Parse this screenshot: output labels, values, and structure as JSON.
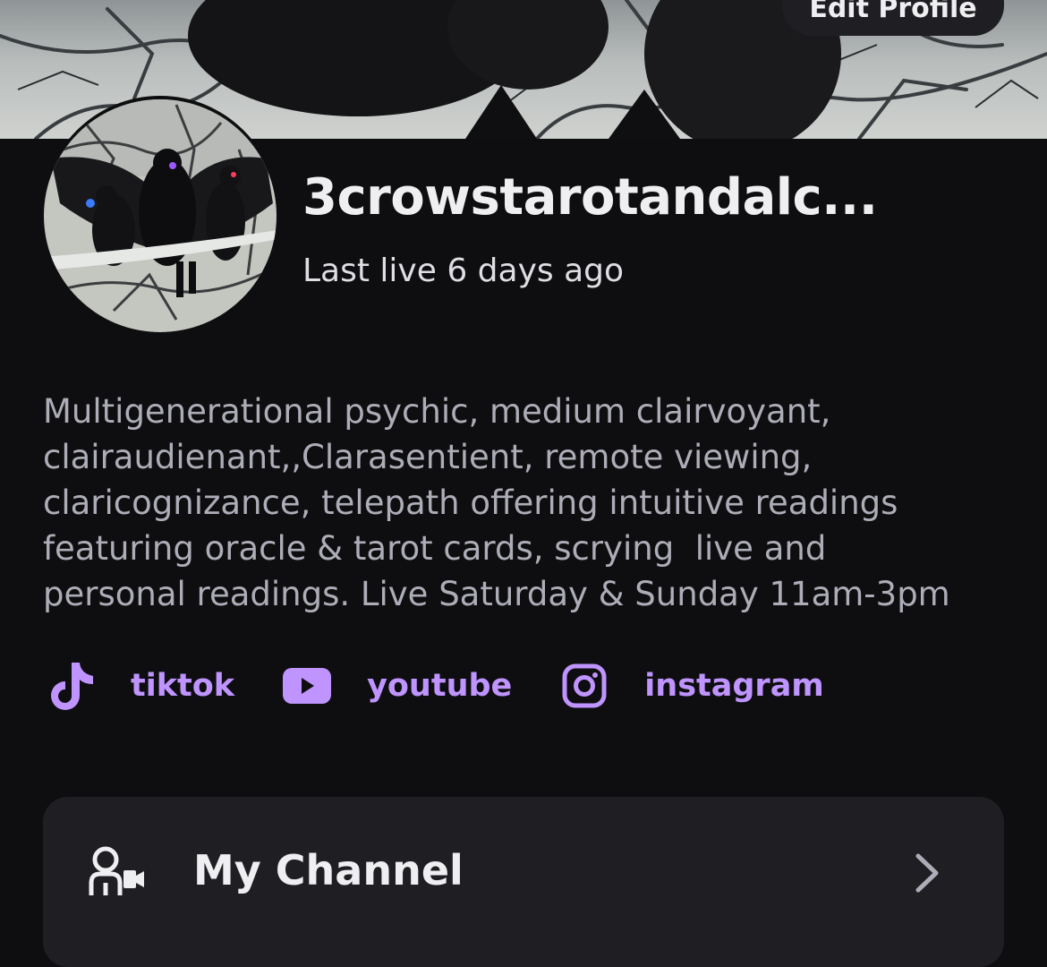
{
  "header": {
    "edit_button_label": "Edit Profile"
  },
  "profile": {
    "channel_name": "3crowstarotandalc...",
    "last_live": "Last live 6 days ago",
    "bio": "Multigenerational psychic, medium clairvoyant,\nclairaudienant,,Clarasentient, remote viewing,\nclaricognizance, telepath offering intuitive readings\nfeaturing oracle & tarot cards, scrying  live and\npersonal readings. Live Saturday & Sunday 11am-3pm"
  },
  "socials": [
    {
      "label": "tiktok",
      "icon": "tiktok-icon"
    },
    {
      "label": "youtube",
      "icon": "youtube-icon"
    },
    {
      "label": "instagram",
      "icon": "instagram-icon"
    }
  ],
  "menu": {
    "my_channel": {
      "label": "My Channel",
      "icon": "channel-user-camera-icon",
      "trailing_icon": "chevron-right-icon"
    }
  },
  "colors": {
    "background": "#0e0e10",
    "accent": "#bf94ff",
    "card": "#1f1f23",
    "muted_text": "#adadb8"
  }
}
